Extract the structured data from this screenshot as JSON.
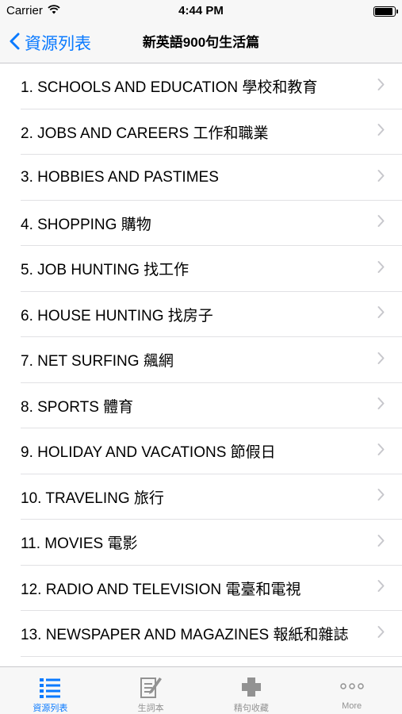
{
  "status_bar": {
    "carrier": "Carrier",
    "time": "4:44 PM",
    "icons": [
      "wifi-icon",
      "battery-icon"
    ]
  },
  "nav_bar": {
    "back_label": "資源列表",
    "title": "新英語900句生活篇",
    "back_icon": "chevron-left-icon"
  },
  "list": {
    "chevron_icon": "chevron-right-icon",
    "items": [
      {
        "label": "1. SCHOOLS AND EDUCATION 學校和教育"
      },
      {
        "label": "2. JOBS AND CAREERS 工作和職業"
      },
      {
        "label": "3. HOBBIES AND PASTIMES"
      },
      {
        "label": "4. SHOPPING 購物"
      },
      {
        "label": "5. JOB HUNTING 找工作"
      },
      {
        "label": "6. HOUSE HUNTING 找房子"
      },
      {
        "label": "7. NET SURFING 飆網"
      },
      {
        "label": "8. SPORTS 體育"
      },
      {
        "label": "9. HOLIDAY AND VACATIONS 節假日"
      },
      {
        "label": "10. TRAVELING 旅行"
      },
      {
        "label": "11. MOVIES 電影"
      },
      {
        "label": "12. RADIO AND TELEVISION 電臺和電視"
      },
      {
        "label": "13. NEWSPAPER AND MAGAZINES 報紙和雜誌"
      }
    ]
  },
  "tab_bar": {
    "tabs": [
      {
        "label": "資源列表",
        "icon": "list-icon",
        "active": true
      },
      {
        "label": "生詞本",
        "icon": "notebook-pencil-icon",
        "active": false
      },
      {
        "label": "精句收藏",
        "icon": "plus-icon",
        "active": false
      },
      {
        "label": "More",
        "icon": "more-dots-icon",
        "active": false
      }
    ]
  },
  "colors": {
    "accent": "#0a7aff",
    "inactive_tab": "#929292",
    "separator": "#e1e1e4",
    "bar_background": "#f7f7f7",
    "chevron": "#c7c7cc"
  }
}
